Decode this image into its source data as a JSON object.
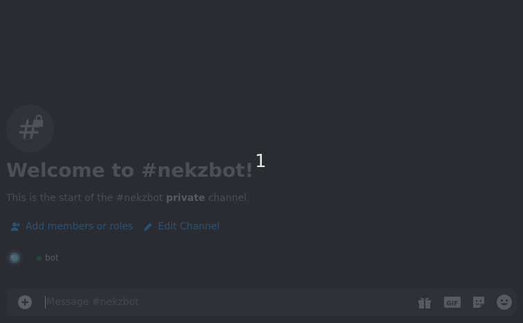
{
  "channel": {
    "icon": "hashtag-lock-icon",
    "welcome_title": "Welcome to #nekzbot!",
    "intro_prefix": "This is the start of the #nekzbot ",
    "intro_bold": "private",
    "intro_suffix": " channel."
  },
  "overlay_number": "1",
  "actions": {
    "add_members_label": "Add members or roles",
    "add_members_icon": "person-add-icon",
    "edit_channel_label": "Edit Channel",
    "edit_channel_icon": "pencil-icon"
  },
  "member": {
    "name": "bot",
    "status": "online",
    "status_color": "#1f4d33"
  },
  "composer": {
    "placeholder": "Message #nekzbot",
    "value": "",
    "tools": [
      "gift-icon",
      "gif-icon",
      "sticker-icon",
      "emoji-icon"
    ],
    "gif_label": "GIF"
  },
  "colors": {
    "background": "#2a2c31",
    "link": "#2c5374",
    "composer_bg": "#2e3138"
  }
}
